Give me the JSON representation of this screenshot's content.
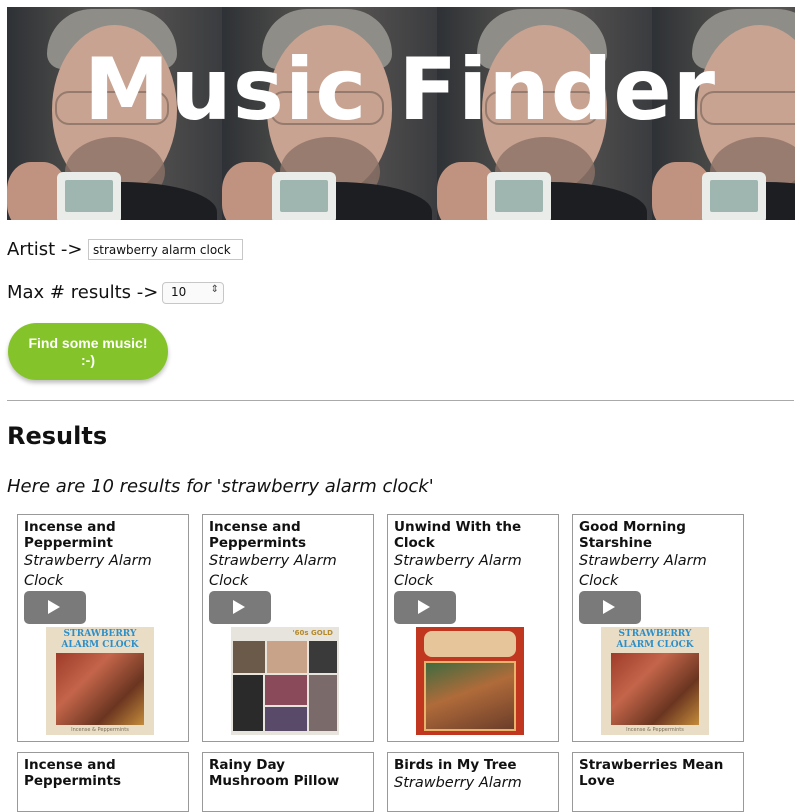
{
  "header": {
    "title": "Music Finder"
  },
  "form": {
    "artist_label": "Artist ->",
    "artist_value": "strawberry alarm clock",
    "max_label": "Max # results ->",
    "max_value": "10",
    "submit_label": "Find some music! :-)"
  },
  "results": {
    "heading": "Results",
    "summary": "Here are 10 results for 'strawberry alarm clock'",
    "items": [
      {
        "title": "Incense and Peppermint",
        "artist": "Strawberry Alarm Clock",
        "cover_band": "STRAWBERRY ALARM CLOCK",
        "cover_foot": "Incense & Peppermints"
      },
      {
        "title": "Incense and Peppermints",
        "artist": "Strawberry Alarm Clock",
        "cover_badge": "'60s GOLD"
      },
      {
        "title": "Unwind With the Clock",
        "artist": "Strawberry Alarm Clock"
      },
      {
        "title": "Good Morning Starshine",
        "artist": "Strawberry Alarm Clock",
        "cover_band": "STRAWBERRY ALARM CLOCK",
        "cover_foot": "Incense & Peppermints"
      },
      {
        "title": "Incense and Peppermints",
        "artist": ""
      },
      {
        "title": "Rainy Day Mushroom Pillow",
        "artist": ""
      },
      {
        "title": "Birds in My Tree",
        "artist": "Strawberry Alarm"
      },
      {
        "title": "Strawberries Mean Love",
        "artist": ""
      }
    ]
  },
  "colors": {
    "button_green": "#84c42a",
    "play_gray": "#7a7a7a",
    "card_border": "#999999"
  }
}
